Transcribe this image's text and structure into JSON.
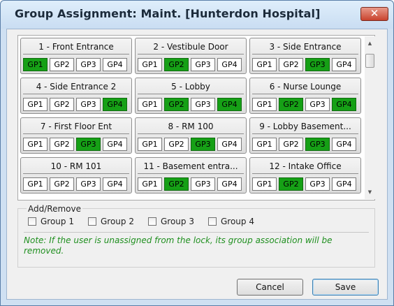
{
  "title": "Group Assignment: Maint. [Hunterdon Hospital]",
  "close_symbol": "✕",
  "group_labels": [
    "GP1",
    "GP2",
    "GP3",
    "GP4"
  ],
  "locks": [
    {
      "name": "1 - Front Entrance",
      "active": [
        1
      ]
    },
    {
      "name": "2 - Vestibule Door",
      "active": [
        2
      ]
    },
    {
      "name": "3 - Side Entrance",
      "active": [
        3
      ]
    },
    {
      "name": "4 - Side Entrance 2",
      "active": [
        4
      ]
    },
    {
      "name": "5 - Lobby",
      "active": [
        2,
        4
      ]
    },
    {
      "name": "6 - Nurse Lounge",
      "active": [
        2,
        4
      ]
    },
    {
      "name": "7 - First Floor Ent",
      "active": [
        3
      ]
    },
    {
      "name": "8 - RM 100",
      "active": [
        3
      ]
    },
    {
      "name": "9 - Lobby Basement...",
      "active": [
        3
      ]
    },
    {
      "name": "10 - RM 101",
      "active": []
    },
    {
      "name": "11 - Basement entra...",
      "active": [
        2
      ]
    },
    {
      "name": "12 - Intake Office",
      "active": [
        2
      ]
    }
  ],
  "addremove": {
    "legend": "Add/Remove",
    "options": [
      "Group 1",
      "Group 2",
      "Group 3",
      "Group 4"
    ],
    "note": "Note: If the user is unassigned from the lock, its group association will be removed."
  },
  "buttons": {
    "cancel": "Cancel",
    "save": "Save"
  },
  "colors": {
    "active_group": "#16a016",
    "note_text": "#1f8f1f"
  }
}
